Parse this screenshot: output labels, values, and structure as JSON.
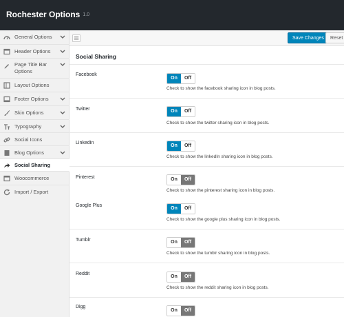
{
  "header": {
    "title": "Rochester Options",
    "version": "1.0"
  },
  "toolbar": {
    "save_label": "Save Changes",
    "reset_label": "Reset Se"
  },
  "sidebar": {
    "items": [
      {
        "label": "General Options",
        "icon": "dashboard-icon",
        "chevron": true
      },
      {
        "label": "Header Options",
        "icon": "window-icon",
        "chevron": true
      },
      {
        "label": "Page Title Bar Options",
        "icon": "pen-icon",
        "chevron": true
      },
      {
        "label": "Layout Options",
        "icon": "layout-icon",
        "chevron": false
      },
      {
        "label": "Footer Options",
        "icon": "window-icon",
        "chevron": true
      },
      {
        "label": "Skin Options",
        "icon": "brush-icon",
        "chevron": true
      },
      {
        "label": "Typography",
        "icon": "text-icon",
        "chevron": true
      },
      {
        "label": "Social Icons",
        "icon": "link-icon",
        "chevron": false
      },
      {
        "label": "Blog Options",
        "icon": "document-icon",
        "chevron": true
      },
      {
        "label": "Social Sharing",
        "icon": "share-icon",
        "chevron": false,
        "active": true
      },
      {
        "label": "Woocommerce",
        "icon": "window-icon",
        "chevron": false
      },
      {
        "label": "Import / Export",
        "icon": "refresh-icon",
        "chevron": false
      }
    ]
  },
  "content": {
    "section_title": "Social Sharing",
    "on_label": "On",
    "off_label": "Off",
    "options": [
      {
        "label": "Facebook",
        "state": "on",
        "desc": "Check to show the facebook sharing icon in blog posts."
      },
      {
        "label": "Twitter",
        "state": "on",
        "desc": "Check to show the twitter sharing icon in blog posts."
      },
      {
        "label": "LinkedIn",
        "state": "on",
        "desc": "Check to show the linkedIn sharing icon in blog posts."
      },
      {
        "label": "Pinterest",
        "state": "off",
        "desc": "Check to show the pinterest sharing icon in blog posts."
      },
      {
        "label": "Google Plus",
        "state": "on",
        "desc": "Check to show the google plus sharing icon in blog posts."
      },
      {
        "label": "Tumblr",
        "state": "off",
        "desc": "Check to show the tumblr sharing icon in blog posts."
      },
      {
        "label": "Reddit",
        "state": "off",
        "desc": "Check to show the reddit sharing icon in blog posts."
      },
      {
        "label": "Digg",
        "state": "off",
        "desc": ""
      }
    ]
  },
  "colors": {
    "header_bg": "#23282d",
    "accent": "#0085ba",
    "off_selected": "#777777"
  }
}
